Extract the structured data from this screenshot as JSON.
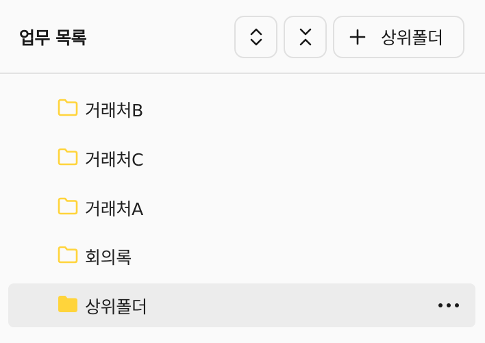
{
  "header": {
    "title": "업무 목록",
    "expand_icon": "chevron-up-down-icon",
    "collapse_icon": "chevron-collapse-icon",
    "add_button_label": "상위폴더",
    "add_icon": "plus-icon"
  },
  "folders": [
    {
      "name": "거래처B",
      "icon": "folder-outline-icon",
      "selected": false
    },
    {
      "name": "거래처C",
      "icon": "folder-outline-icon",
      "selected": false
    },
    {
      "name": "거래처A",
      "icon": "folder-outline-icon",
      "selected": false
    },
    {
      "name": "회의록",
      "icon": "folder-outline-icon",
      "selected": false
    },
    {
      "name": "상위폴더",
      "icon": "folder-filled-icon",
      "selected": true,
      "more_icon": "more-horizontal-icon"
    }
  ],
  "colors": {
    "folder": "#ffd43b",
    "selected_row": "#ececec",
    "divider": "#e2e2e2"
  }
}
